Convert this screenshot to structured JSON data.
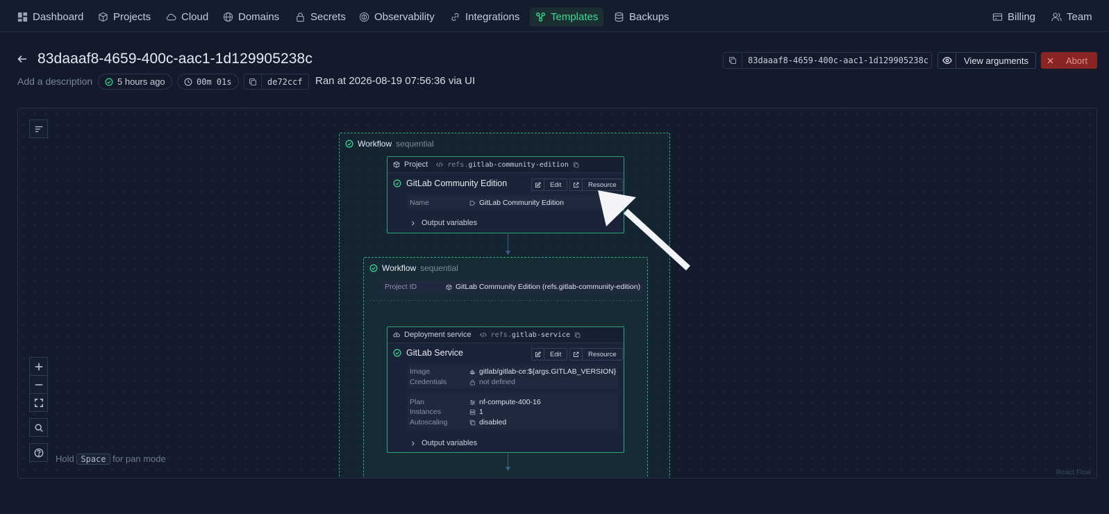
{
  "nav": {
    "left": [
      {
        "label": "Dashboard",
        "icon": "dashboard-icon"
      },
      {
        "label": "Projects",
        "icon": "box-icon"
      },
      {
        "label": "Cloud",
        "icon": "cloud-icon"
      },
      {
        "label": "Domains",
        "icon": "globe-icon"
      },
      {
        "label": "Secrets",
        "icon": "lock-icon"
      },
      {
        "label": "Observability",
        "icon": "observability-icon"
      },
      {
        "label": "Integrations",
        "icon": "link-icon"
      },
      {
        "label": "Templates",
        "icon": "templates-icon",
        "active": true
      },
      {
        "label": "Backups",
        "icon": "database-icon"
      }
    ],
    "right": [
      {
        "label": "Billing",
        "icon": "credit-card-icon"
      },
      {
        "label": "Team",
        "icon": "team-icon"
      }
    ]
  },
  "header": {
    "title": "83daaaf8-4659-400c-aac1-1d129905238c",
    "description_placeholder": "Add a description",
    "time_ago": "5 hours ago",
    "duration": "00m 01s",
    "commit": "de72ccf",
    "ran_at": "Ran at 2026-08-19 07:56:36 via UI",
    "run_id": "83daaaf8-4659-400c-aac1-1d129905238c",
    "view_arguments": "View arguments",
    "abort": "Abort"
  },
  "colors": {
    "accent": "#3ddc97",
    "abort_bg": "#8a2525",
    "background": "#121a2b"
  },
  "canvas": {
    "hint_prefix": "Hold",
    "hint_key": "Space",
    "hint_suffix": "for pan mode",
    "attribution": "React Flow",
    "workflow_outer": {
      "label": "Workflow",
      "mode": "sequential"
    },
    "project_node": {
      "type": "Project",
      "ref_prefix": "refs.",
      "ref_name": "gitlab-community-edition",
      "title": "GitLab Community Edition",
      "edit": "Edit",
      "resource": "Resource",
      "name_key": "Name",
      "name_value": "GitLab Community Edition",
      "output_vars": "Output variables"
    },
    "workflow_inner": {
      "label": "Workflow",
      "mode": "sequential",
      "project_id_key": "Project ID",
      "project_id_value": "GitLab Community Edition (refs.gitlab-community-edition)"
    },
    "service_node": {
      "type": "Deployment service",
      "ref_prefix": "refs.",
      "ref_name": "gitlab-service",
      "title": "GitLab Service",
      "edit": "Edit",
      "resource": "Resource",
      "image_key": "Image",
      "image_value": "gitlab/gitlab-ce:${args.GITLAB_VERSION}",
      "credentials_key": "Credentials",
      "credentials_value": "not defined",
      "plan_key": "Plan",
      "plan_value": "nf-compute-400-16",
      "instances_key": "Instances",
      "instances_value": "1",
      "autoscaling_key": "Autoscaling",
      "autoscaling_value": "disabled",
      "output_vars": "Output variables"
    }
  }
}
